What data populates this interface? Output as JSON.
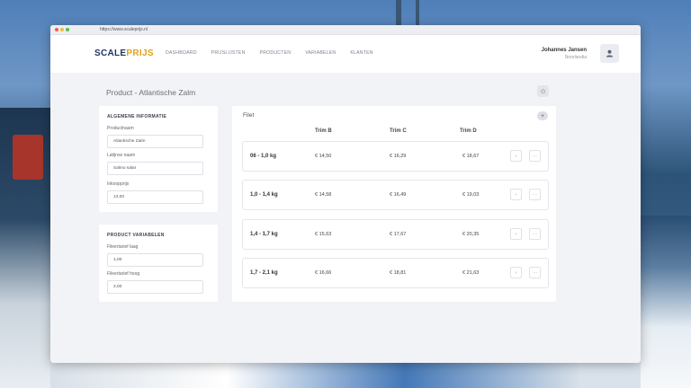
{
  "browser": {
    "url": "https://www.scaleprijs.nl"
  },
  "nav": {
    "logo_part1": "SCALE",
    "logo_part2": "PRIJS",
    "items": [
      "DASHBOARD",
      "PRIJSLIJSTEN",
      "PRODUCTEN",
      "VARIABELEN",
      "KLANTEN"
    ]
  },
  "user": {
    "name": "Johannes Jansen",
    "location": "Noorlandia"
  },
  "page": {
    "title": "Product - Atlantische Zalm"
  },
  "general": {
    "heading": "ALGEMENE INFORMATIE",
    "fields": [
      {
        "label": "Productnaam",
        "value": "Atlantische Zalm"
      },
      {
        "label": "Latijnse naam",
        "value": "Salmo salar"
      },
      {
        "label": "Inkoopprijs",
        "value": "13,00"
      }
    ]
  },
  "variables": {
    "heading": "PRODUCT VARIABELEN",
    "fields": [
      {
        "label": "Fileertarief laag",
        "value": "1,00"
      },
      {
        "label": "Fileertarief hoog",
        "value": "2,00"
      }
    ]
  },
  "table": {
    "title": "Filet",
    "columns": [
      "Trim B",
      "Trim C",
      "Trim D"
    ],
    "rows": [
      {
        "label": "06 - 1,0 kg",
        "values": [
          "€ 14,50",
          "€ 16,29",
          "€ 18,67"
        ]
      },
      {
        "label": "1,0 - 1,4 kg",
        "values": [
          "€ 14,58",
          "€ 16,49",
          "€ 19,03"
        ]
      },
      {
        "label": "1,4 - 1,7 kg",
        "values": [
          "€ 15,63",
          "€ 17,67",
          "€ 20,35"
        ]
      },
      {
        "label": "1,7 - 2,1 kg",
        "values": [
          "€ 16,66",
          "€ 18,81",
          "€ 21,63"
        ]
      }
    ]
  },
  "colors": {
    "brand_dark": "#1f3566",
    "brand_accent": "#e2a21a"
  },
  "icons": {
    "avatar": "user-icon",
    "page_action": "settings-icon",
    "add": "plus-icon",
    "row_edit": "edit-icon",
    "row_more": "more-icon"
  }
}
